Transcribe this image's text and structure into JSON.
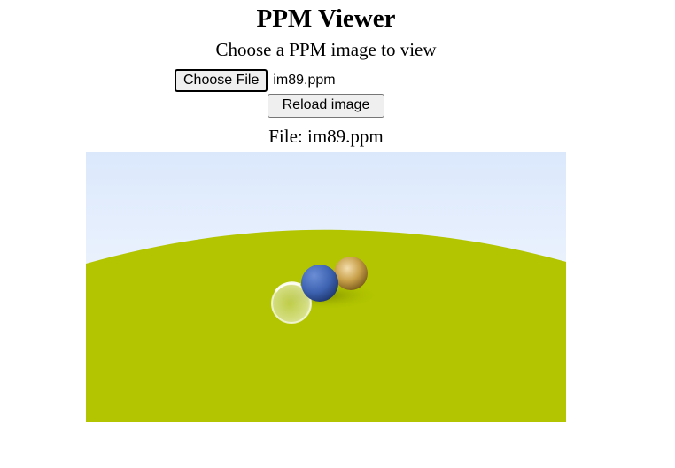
{
  "header": {
    "title": "PPM Viewer",
    "subtitle": "Choose a PPM image to view"
  },
  "file_input": {
    "button_label": "Choose File",
    "selected_file": "im89.ppm"
  },
  "reload": {
    "button_label": "Reload image"
  },
  "viewer": {
    "file_label": "File: im89.ppm"
  },
  "colors": {
    "sky_top": "#dbe8fc",
    "sky_bottom": "#ffffff",
    "ground": "#b2c500",
    "sphere_blue": "#3d62b0",
    "sphere_gold": "#c8a04a"
  }
}
